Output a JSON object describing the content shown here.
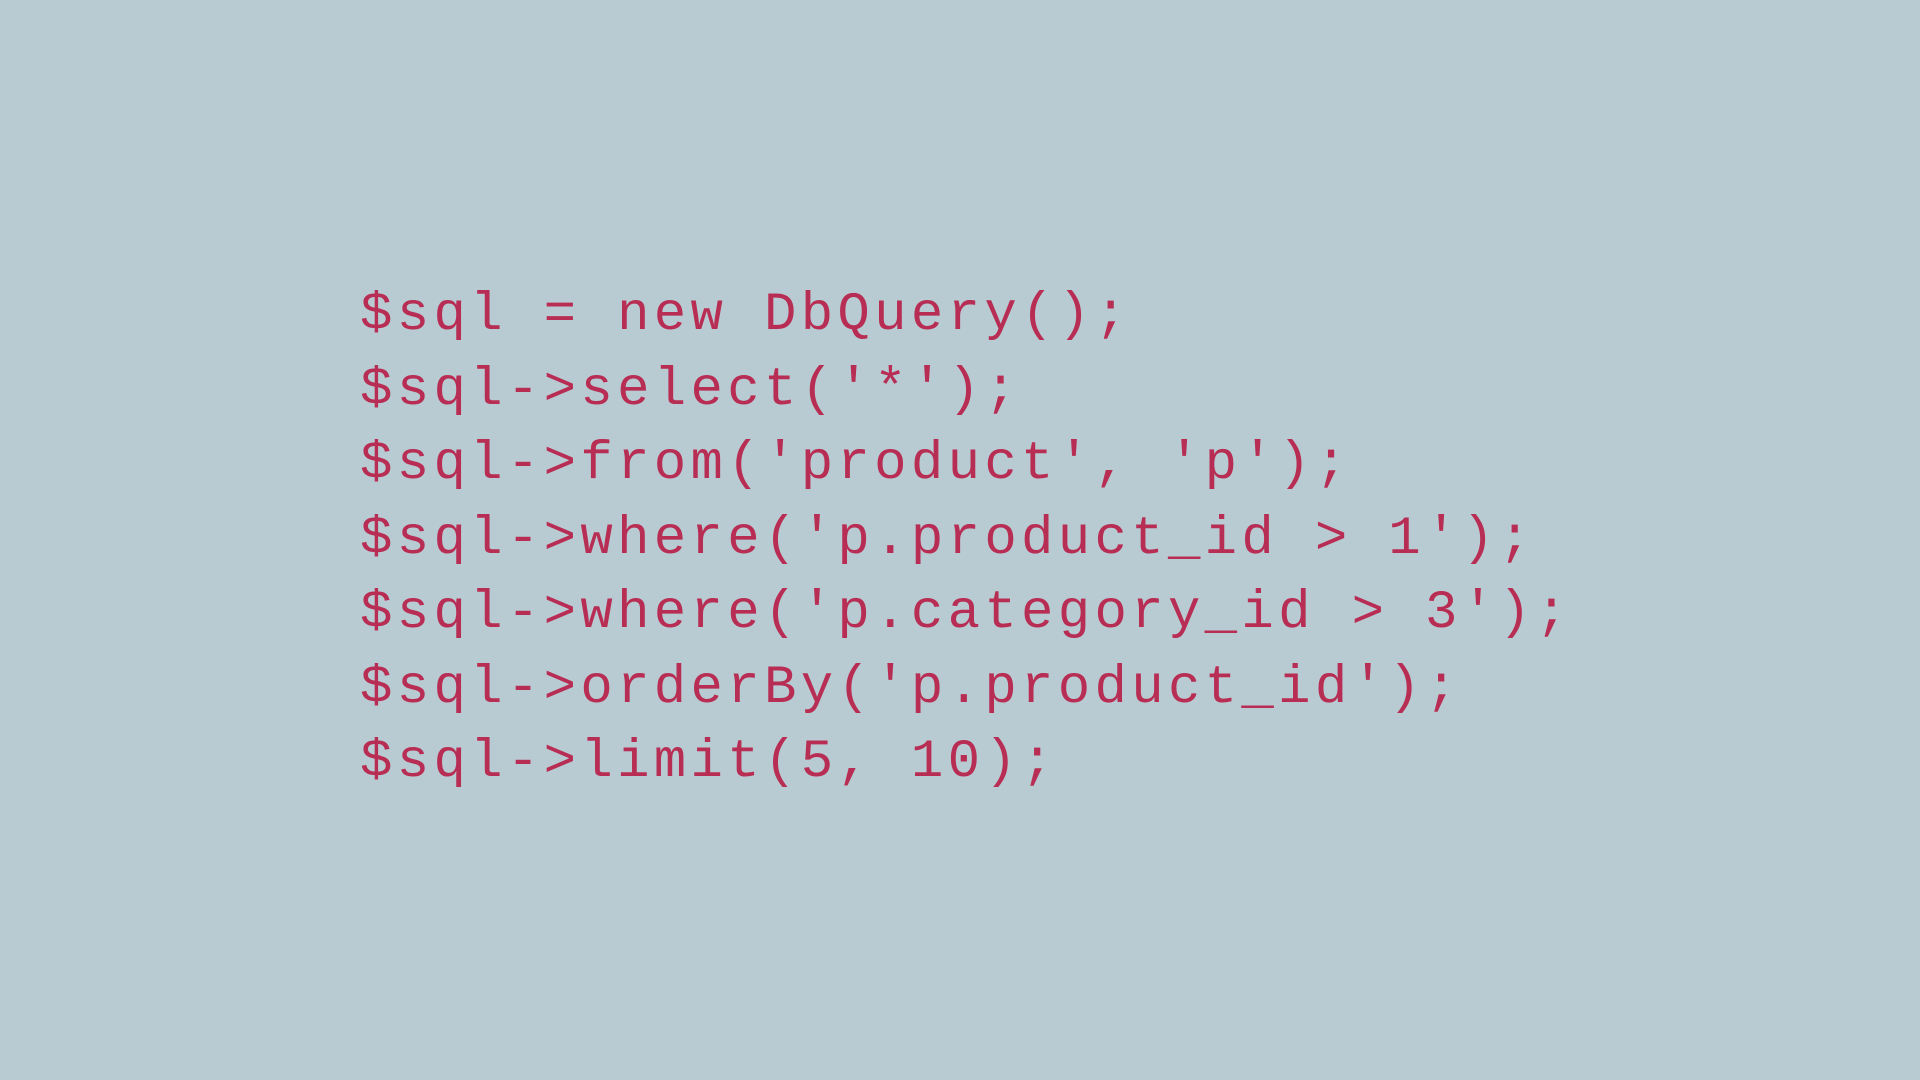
{
  "code": {
    "lines": [
      "$sql = new DbQuery();",
      "$sql->select('*');",
      "$sql->from('product', 'p');",
      "$sql->where('p.product_id > 1');",
      "$sql->where('p.category_id > 3');",
      "$sql->orderBy('p.product_id');",
      "$sql->limit(5, 10);"
    ]
  }
}
